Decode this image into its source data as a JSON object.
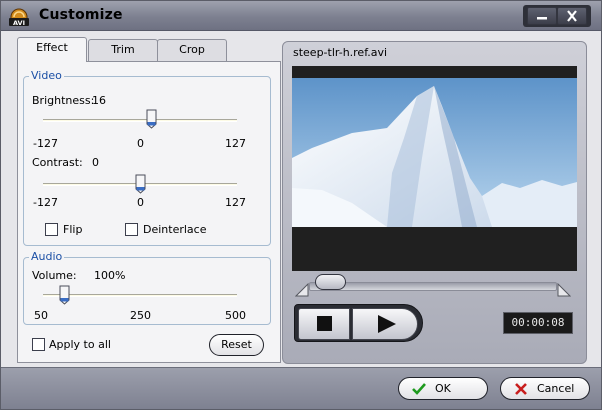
{
  "window": {
    "title": "Customize",
    "app_icon_text": "AVI"
  },
  "tabs": [
    {
      "label": "Effect",
      "active": true
    },
    {
      "label": "Trim",
      "active": false
    },
    {
      "label": "Crop",
      "active": false
    }
  ],
  "video": {
    "group_label": "Video",
    "brightness": {
      "label": "Brightness:",
      "value": "16",
      "min": "-127",
      "mid": "0",
      "max": "127",
      "level": 16
    },
    "contrast": {
      "label": "Contrast:",
      "value": "0",
      "min": "-127",
      "mid": "0",
      "max": "127",
      "level": 0
    },
    "flip_label": "Flip",
    "deinterlace_label": "Deinterlace",
    "flip_checked": false,
    "deinterlace_checked": false
  },
  "audio": {
    "group_label": "Audio",
    "volume": {
      "label": "Volume:",
      "value": "100%",
      "min": "50",
      "mid": "250",
      "max": "500",
      "level": 100
    }
  },
  "apply_to_all_label": "Apply to all",
  "apply_to_all_checked": false,
  "reset_label": "Reset",
  "preview": {
    "filename": "steep-tlr-h.ref.avi",
    "time": "00:00:08"
  },
  "ok_label": "OK",
  "cancel_label": "Cancel",
  "colors": {
    "accent_blue": "#1b4fa5",
    "ok_green": "#1e9a1e",
    "cancel_red": "#c81e1e"
  }
}
